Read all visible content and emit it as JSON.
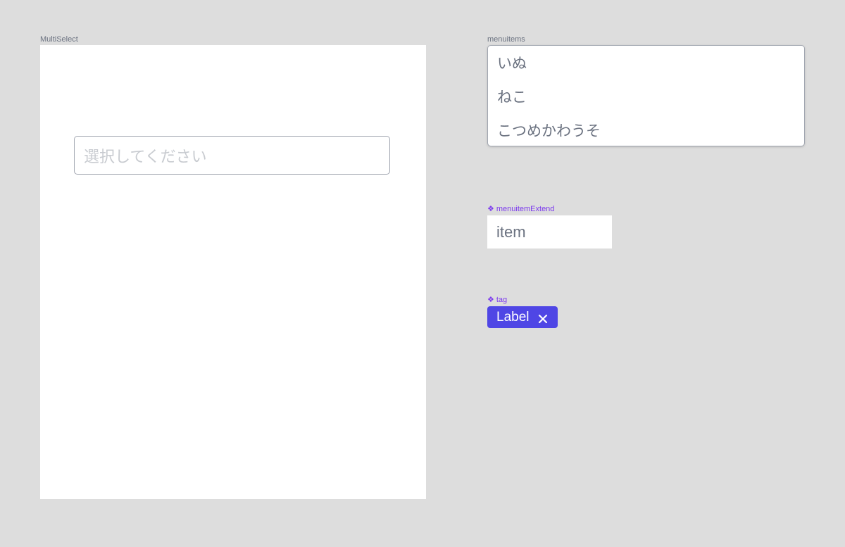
{
  "multiselect": {
    "frame_label": "MultiSelect",
    "placeholder": "選択してください"
  },
  "menuitems": {
    "frame_label": "menuitems",
    "items": [
      "いぬ",
      "ねこ",
      "こつめかわうそ"
    ]
  },
  "menuitem_extend": {
    "component_label": "menuitemExtend",
    "text": "item"
  },
  "tag": {
    "component_label": "tag",
    "label": "Label",
    "close_icon": "close-icon"
  },
  "colors": {
    "canvas": "#dddddd",
    "tag_bg": "#4f46e5",
    "component_label": "#7c3aed",
    "menu_text": "#6b7280",
    "placeholder": "#c8cbd0"
  }
}
